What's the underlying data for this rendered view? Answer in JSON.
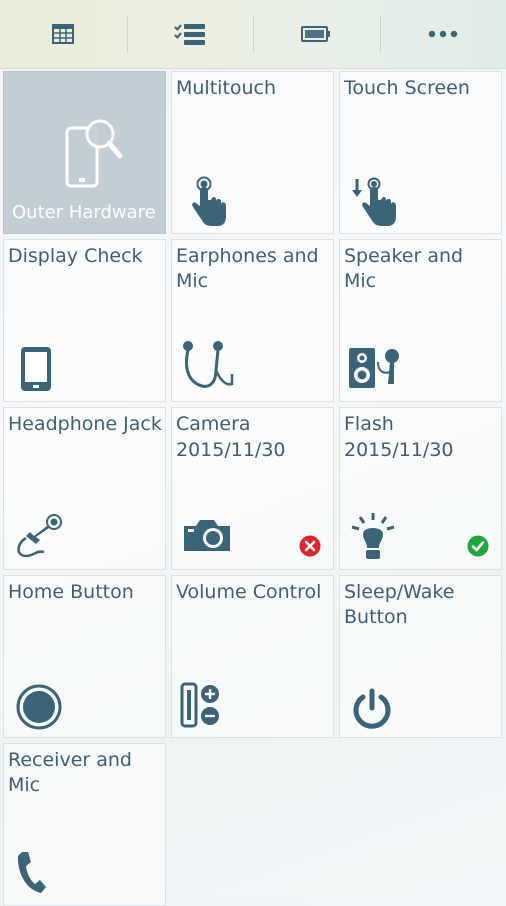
{
  "toolbar": {
    "tabs": [
      {
        "name": "report-tab",
        "icon": "table-icon"
      },
      {
        "name": "checklist-tab",
        "icon": "checklist-icon"
      },
      {
        "name": "battery-tab",
        "icon": "battery-icon"
      },
      {
        "name": "more-tab",
        "icon": "more-dots-icon"
      }
    ]
  },
  "tiles": [
    {
      "label": "Outer Hardware",
      "icon": "phone-magnifier-icon",
      "selected": true
    },
    {
      "label": "Multitouch",
      "icon": "multitouch-hand-icon"
    },
    {
      "label": "Touch Screen",
      "icon": "touch-down-hand-icon"
    },
    {
      "label": "Display Check",
      "icon": "smartphone-icon"
    },
    {
      "label": "Earphones and\nMic",
      "icon": "earphones-icon"
    },
    {
      "label": "Speaker and Mic",
      "icon": "speaker-mic-icon"
    },
    {
      "label": "Headphone Jack",
      "icon": "audio-jack-icon"
    },
    {
      "label": "Camera",
      "date": "2015/11/30",
      "icon": "camera-icon",
      "status": "fail"
    },
    {
      "label": "Flash",
      "date": "2015/11/30",
      "icon": "flash-bulb-icon",
      "status": "pass"
    },
    {
      "label": "Home Button",
      "icon": "home-button-icon"
    },
    {
      "label": "Volume Control",
      "icon": "volume-control-icon"
    },
    {
      "label": "Sleep/Wake\nButton",
      "icon": "power-icon"
    },
    {
      "label": "Receiver and Mic",
      "icon": "phone-handset-icon"
    }
  ],
  "colors": {
    "icon": "#3b6478",
    "text": "#3e5f73",
    "selected_bg": "#c2ced5",
    "fail": "#e0242c",
    "pass": "#1ea83c"
  }
}
